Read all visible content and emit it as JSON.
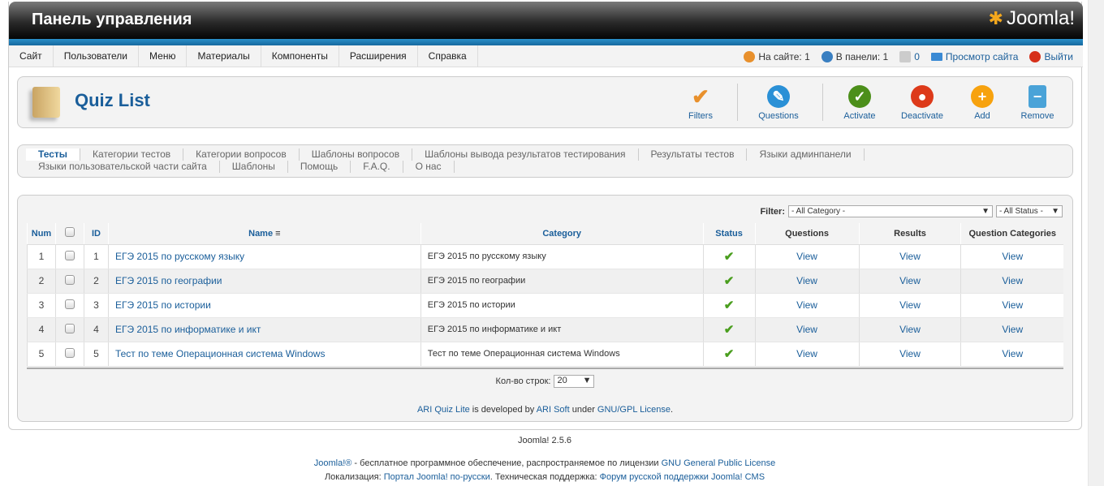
{
  "header": {
    "title": "Панель управления",
    "logo": "Joomla!"
  },
  "menu": [
    "Сайт",
    "Пользователи",
    "Меню",
    "Материалы",
    "Компоненты",
    "Расширения",
    "Справка"
  ],
  "status": {
    "online": "На сайте: 1",
    "admin": "В панели: 1",
    "messages": "0",
    "view_site": "Просмотр сайта",
    "logout": "Выйти"
  },
  "page_title": "Quiz List",
  "toolbar": {
    "filters": "Filters",
    "questions": "Questions",
    "activate": "Activate",
    "deactivate": "Deactivate",
    "add": "Add",
    "remove": "Remove"
  },
  "submenu": [
    [
      "Тесты",
      "Категории тестов",
      "Категории вопросов",
      "Шаблоны вопросов",
      "Шаблоны вывода результатов тестирования",
      "Результаты тестов",
      "Языки админпанели"
    ],
    [
      "Языки пользовательской части сайта",
      "Шаблоны",
      "Помощь",
      "F.A.Q.",
      "О нас"
    ]
  ],
  "filter": {
    "label": "Filter:",
    "category": "- All Category -",
    "status": "- All Status -"
  },
  "columns": [
    "Num",
    "",
    "ID",
    "Name",
    "Category",
    "Status",
    "Questions",
    "Results",
    "Question Categories"
  ],
  "rows": [
    {
      "num": "1",
      "id": "1",
      "name": "ЕГЭ 2015 по русскому языку",
      "category": "ЕГЭ 2015 по русскому языку",
      "q": "View",
      "r": "View",
      "qc": "View"
    },
    {
      "num": "2",
      "id": "2",
      "name": "ЕГЭ 2015 по географии",
      "category": "ЕГЭ 2015 по географии",
      "q": "View",
      "r": "View",
      "qc": "View"
    },
    {
      "num": "3",
      "id": "3",
      "name": "ЕГЭ 2015 по истории",
      "category": "ЕГЭ 2015 по истории",
      "q": "View",
      "r": "View",
      "qc": "View"
    },
    {
      "num": "4",
      "id": "4",
      "name": "ЕГЭ 2015 по информатике и икт",
      "category": "ЕГЭ 2015 по информатике и икт",
      "q": "View",
      "r": "View",
      "qc": "View"
    },
    {
      "num": "5",
      "id": "5",
      "name": "Тест по теме Операционная система Windows",
      "category": "Тест по теме Операционная система Windows",
      "q": "View",
      "r": "View",
      "qc": "View"
    }
  ],
  "pagination": {
    "label": "Кол-во строк:",
    "value": "20"
  },
  "credit": {
    "product": "ARI Quiz Lite",
    "t1": " is developed by ",
    "company": "ARI Soft",
    "t2": " under ",
    "license": "GNU/GPL License",
    "t3": "."
  },
  "footer": {
    "version": "Joomla! 2.5.6",
    "l1a": "Joomla!®",
    "l1b": " - бесплатное программное обеспечение, распространяемое по лицензии ",
    "l1c": "GNU General Public License",
    "l2a": "Локализация: ",
    "l2b": "Портал Joomla! по-русски",
    "l2c": ". Техническая поддержка: ",
    "l2d": "Форум русской поддержки Joomla! CMS"
  }
}
